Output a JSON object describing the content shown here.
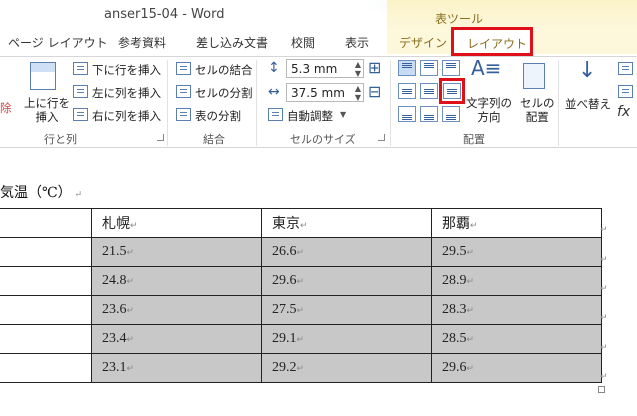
{
  "window": {
    "title": "anser15-04 - Word",
    "contextual_group": "表ツール"
  },
  "tabs": {
    "page_layout": "ページ レイアウト",
    "references": "参考資料",
    "mailings": "差し込み文書",
    "review": "校閲",
    "view": "表示",
    "design": "デザイン",
    "layout": "レイアウト"
  },
  "ribbon": {
    "rows_cols": {
      "delete_partial": "除",
      "insert_above": "上に行を\n挿入",
      "insert_below": "下に行を挿入",
      "insert_left": "左に列を挿入",
      "insert_right": "右に列を挿入",
      "label": "行と列"
    },
    "merge": {
      "merge_cells": "セルの結合",
      "split_cells": "セルの分割",
      "split_table": "表の分割",
      "label": "結合"
    },
    "cell_size": {
      "height": "5.3 mm",
      "width": "37.5 mm",
      "autofit": "自動調整",
      "label": "セルのサイズ"
    },
    "alignment": {
      "text_direction": "文字列の\n方向",
      "cell_margins": "セルの\n配置",
      "label": "配置"
    },
    "data": {
      "sort": "並べ替え"
    }
  },
  "document": {
    "heading": "気温（℃）",
    "columns": [
      "札幌",
      "東京",
      "那覇"
    ],
    "rows": [
      [
        "21.5",
        "26.6",
        "29.5"
      ],
      [
        "24.8",
        "29.6",
        "28.9"
      ],
      [
        "23.6",
        "27.5",
        "28.3"
      ],
      [
        "23.4",
        "29.1",
        "28.5"
      ],
      [
        "23.1",
        "29.2",
        "29.6"
      ]
    ]
  }
}
